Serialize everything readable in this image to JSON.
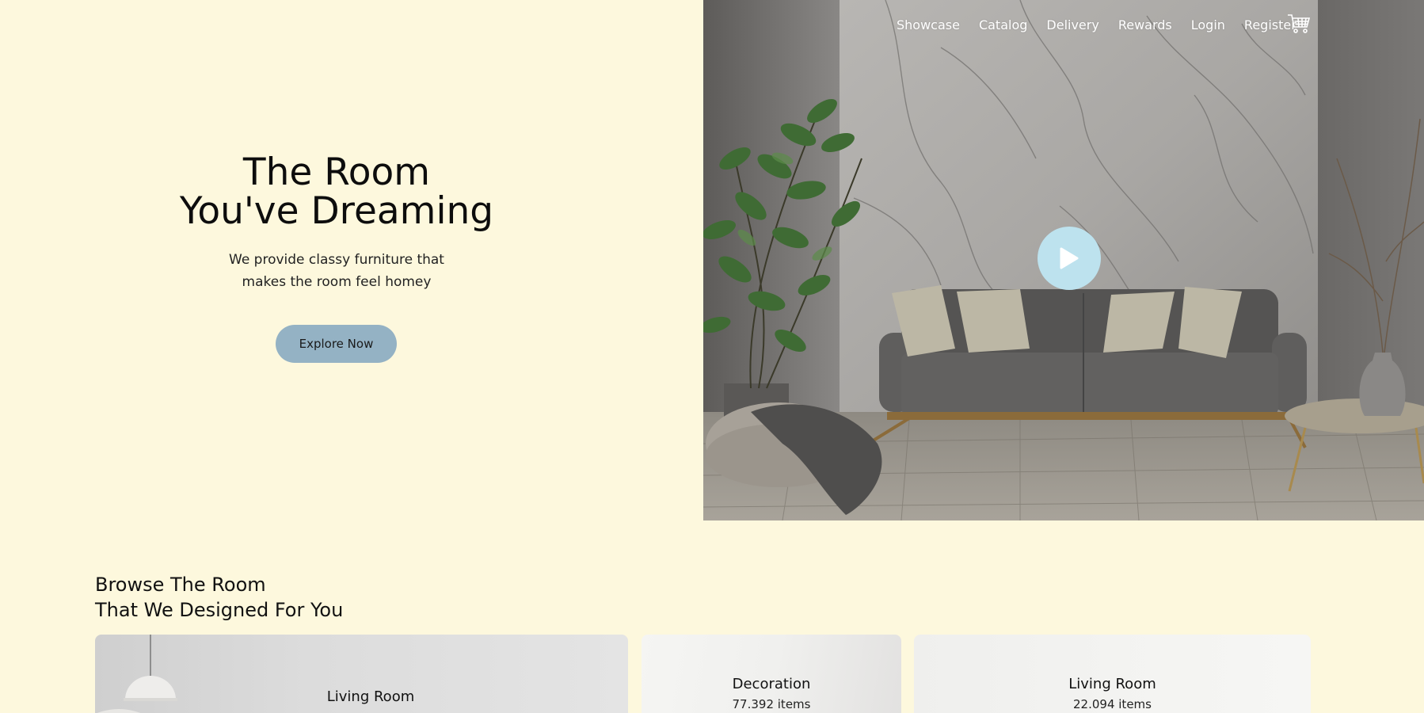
{
  "hero": {
    "title_line1": "The Room",
    "title_line2": "You've Dreaming",
    "subtitle_line1": "We provide classy furniture that",
    "subtitle_line2": "makes the room feel homey",
    "cta_label": "Explore Now"
  },
  "nav": {
    "items": [
      "Showcase",
      "Catalog",
      "Delivery",
      "Rewards",
      "Login",
      "Register"
    ],
    "cart_icon": "cart-icon"
  },
  "media": {
    "play_icon": "play-icon"
  },
  "browse": {
    "title_line1": "Browse The Room",
    "title_line2": "That We Designed For You",
    "cards": [
      {
        "name": "Living Room",
        "count": ""
      },
      {
        "name": "Decoration",
        "count": "77.392 items"
      },
      {
        "name": "Living Room",
        "count": "22.094 items"
      }
    ]
  },
  "colors": {
    "background": "#fdf8dd",
    "button": "#94b2c4",
    "play_button": "#bde2ee"
  }
}
